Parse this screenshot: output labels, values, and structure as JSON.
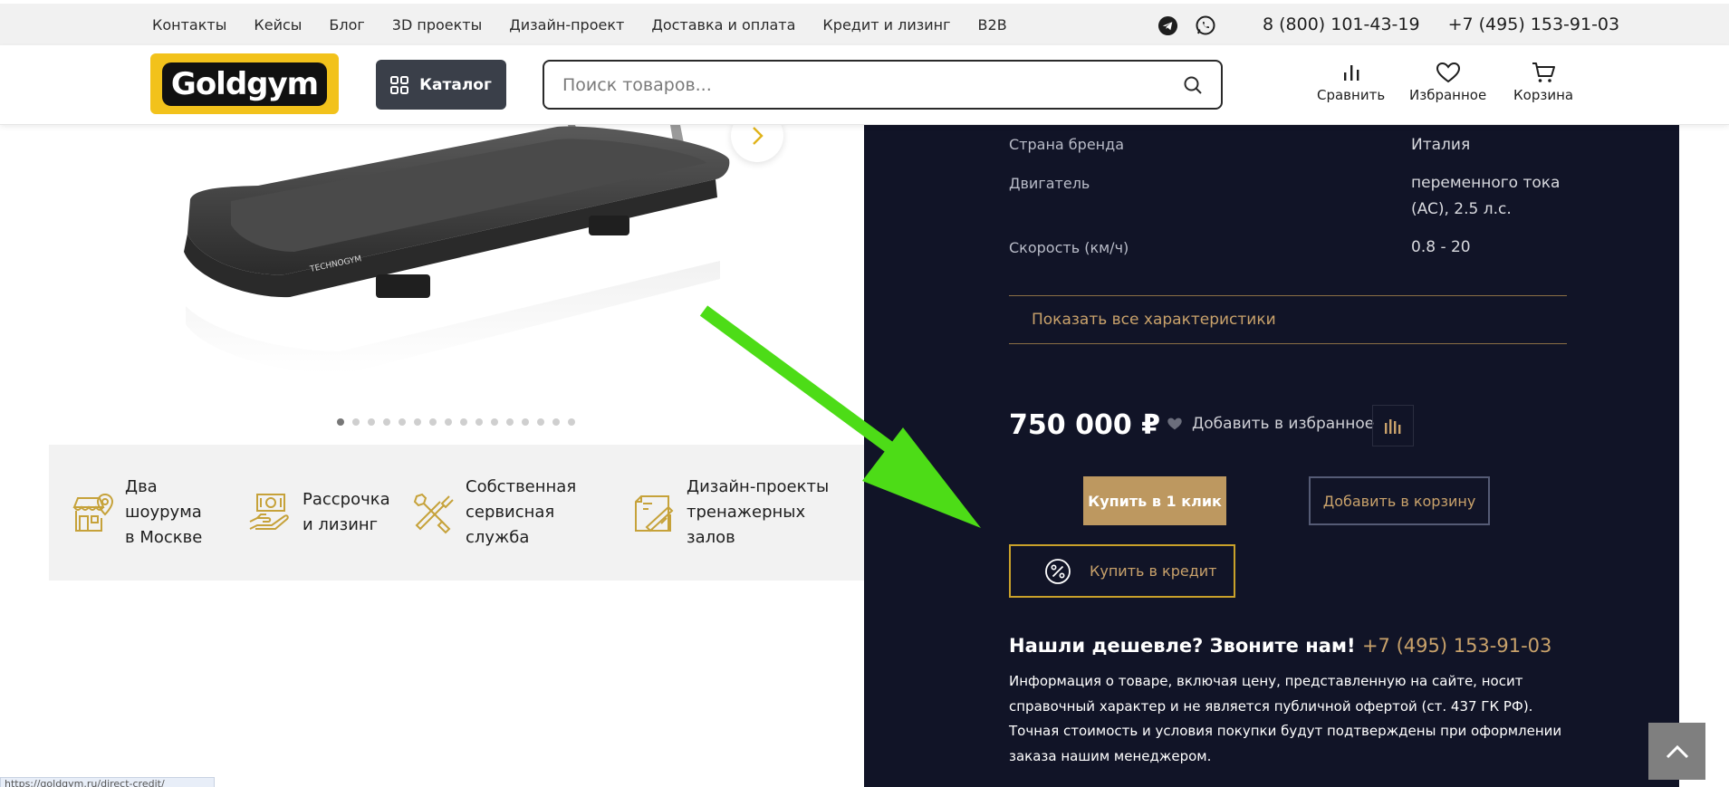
{
  "topnav": {
    "links": [
      "Контакты",
      "Кейсы",
      "Блог",
      "3D проекты",
      "Дизайн-проект",
      "Доставка и оплата",
      "Кредит и лизинг",
      "B2B"
    ],
    "messengers": [
      {
        "icon": "telegram-icon"
      },
      {
        "icon": "whatsapp-icon"
      }
    ],
    "phones": [
      "8 (800) 101-43-19",
      "+7 (495) 153-91-03"
    ]
  },
  "header": {
    "logo_text": "Goldgym",
    "catalog_label": "Каталог",
    "search_placeholder": "Поиск товаров...",
    "actions": [
      {
        "label": "Сравнить",
        "icon": "compare-icon"
      },
      {
        "label": "Избранное",
        "icon": "heart-icon"
      },
      {
        "label": "Корзина",
        "icon": "cart-icon"
      }
    ]
  },
  "gallery": {
    "total_dots": 16,
    "active_dot": 1,
    "product_brand_mark": "TECHNOGYM"
  },
  "features": [
    {
      "icon": "shop-location-icon",
      "text": [
        "Два",
        "шоурума",
        "в Москве"
      ]
    },
    {
      "icon": "hand-money-icon",
      "text": [
        "Рассрочка",
        "и лизинг"
      ]
    },
    {
      "icon": "tools-icon",
      "text": [
        "Собственная",
        "сервисная",
        "служба"
      ]
    },
    {
      "icon": "design-draft-icon",
      "text": [
        "Дизайн-проекты",
        "тренажерных",
        "залов"
      ]
    }
  ],
  "specs": [
    {
      "name": "Страна бренда",
      "value": "Италия"
    },
    {
      "name": "Двигатель",
      "value": "переменного тока (AC), 2.5 л.с."
    },
    {
      "name": "Скорость (км/ч)",
      "value": "0.8 - 20"
    }
  ],
  "show_all_label": "Показать все характеристики",
  "price": "750 000 ₽",
  "favorite_label": "Добавить в избранное",
  "buy_one_click": "Купить в 1 клик",
  "add_to_cart": "Добавить в корзину",
  "buy_credit": "Купить в кредит",
  "cheaper": {
    "text": "Нашли дешевле? Звоните нам!",
    "phone": "+7 (495) 153-91-03"
  },
  "info_text": "Информация о товаре, включая цену, представленную на сайте, носит справочный характер и не является публичной офертой (ст. 437 ГК РФ). Точная стоимость и условия покупки будут подтверждены при оформлении заказа нашим менеджером.",
  "status_url": "https://goldgym.ru/direct-credit/",
  "colors": {
    "gold": "#c9a26b",
    "panel": "#111427",
    "arrow": "#4ddc17",
    "logo_yellow": "#f2c21b"
  }
}
